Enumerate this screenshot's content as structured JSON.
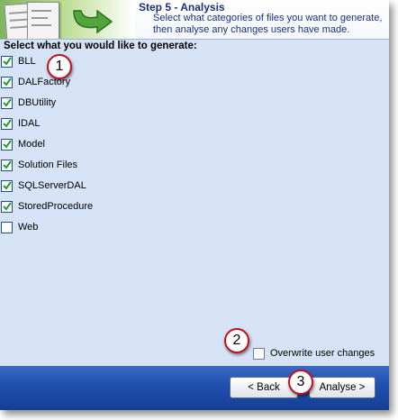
{
  "header": {
    "title": "Step 5 - Analysis",
    "subtitle": "Select what categories of files you want to generate, then analyse any changes users have made."
  },
  "content": {
    "prompt": "Select what you would like to generate:",
    "categories": [
      {
        "label": "BLL",
        "checked": true
      },
      {
        "label": "DALFactory",
        "checked": true
      },
      {
        "label": "DBUtility",
        "checked": true
      },
      {
        "label": "IDAL",
        "checked": true
      },
      {
        "label": "Model",
        "checked": true
      },
      {
        "label": "Solution Files",
        "checked": true
      },
      {
        "label": "SQLServerDAL",
        "checked": true
      },
      {
        "label": "StoredProcedure",
        "checked": true
      },
      {
        "label": "Web",
        "checked": false
      }
    ],
    "overwrite": {
      "label": "Overwrite user changes",
      "checked": false
    }
  },
  "footer": {
    "back_label": "< Back",
    "analyse_label": "Analyse >"
  },
  "badges": [
    "1",
    "2",
    "3"
  ],
  "colors": {
    "title": "#1c2f7a",
    "panel": "#d6e3f6",
    "footer": "#1f4fae",
    "check": "#1f9e2f",
    "badge_ring": "#c1121f"
  },
  "icons": [
    "checkmark-icon",
    "wizard-header-graphic",
    "green-arrow-icon"
  ]
}
